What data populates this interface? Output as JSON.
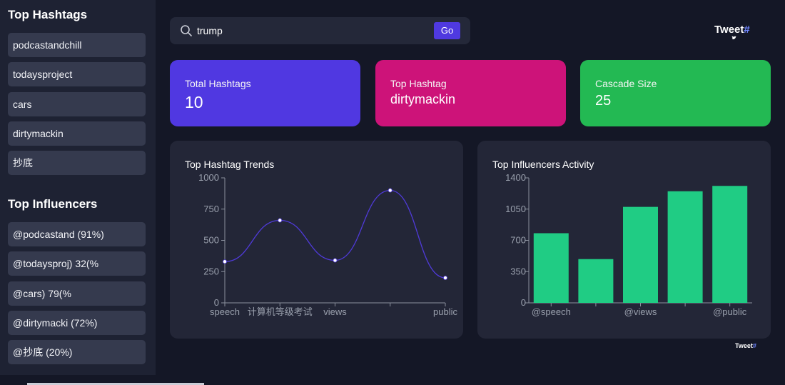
{
  "sidebar": {
    "hashtags_title": "Top Hashtags",
    "hashtags": [
      "podcastandchill",
      "todaysproject",
      "cars",
      "dirtymackin",
      "抄底"
    ],
    "influencers_title": "Top Influencers",
    "influencers": [
      "@podcastand (91%)",
      "@todaysproj) 32(%",
      "@cars) 79(%",
      "@dirtymacki (72%)",
      "@抄底 (20%)"
    ]
  },
  "search": {
    "value": "trump",
    "button_label": "Go"
  },
  "logo": {
    "text": "Tweet",
    "hash": "#"
  },
  "stats": {
    "total_label": "Total Hashtags",
    "total_value": "10",
    "top_label": "Top Hashtag",
    "top_value": "dirtymackin",
    "cascade_label": "Cascade Size",
    "cascade_value": "25"
  },
  "colors": {
    "accent": "#4f39e0",
    "card_purple": "#5038e1",
    "card_pink": "#cd1379",
    "card_green": "#23b953",
    "bar_green": "#20cc84",
    "line": "#4f3ad8"
  },
  "chart_data": [
    {
      "type": "line",
      "title": "Top Hashtag Trends",
      "categories": [
        "speech",
        "计算机等级考试",
        "views",
        "",
        "public"
      ],
      "values": [
        330,
        660,
        340,
        900,
        200
      ],
      "ylim": [
        0,
        1000
      ],
      "yticks": [
        0,
        250,
        500,
        750,
        1000
      ],
      "smooth": true,
      "grid": false
    },
    {
      "type": "bar",
      "title": "Top Influencers Activity",
      "categories": [
        "@speech",
        "",
        "@views",
        "",
        "@public"
      ],
      "values": [
        780,
        490,
        1075,
        1250,
        1310
      ],
      "ylim": [
        0,
        1400
      ],
      "yticks": [
        0,
        350,
        700,
        1050,
        1400
      ],
      "grid": false
    }
  ]
}
